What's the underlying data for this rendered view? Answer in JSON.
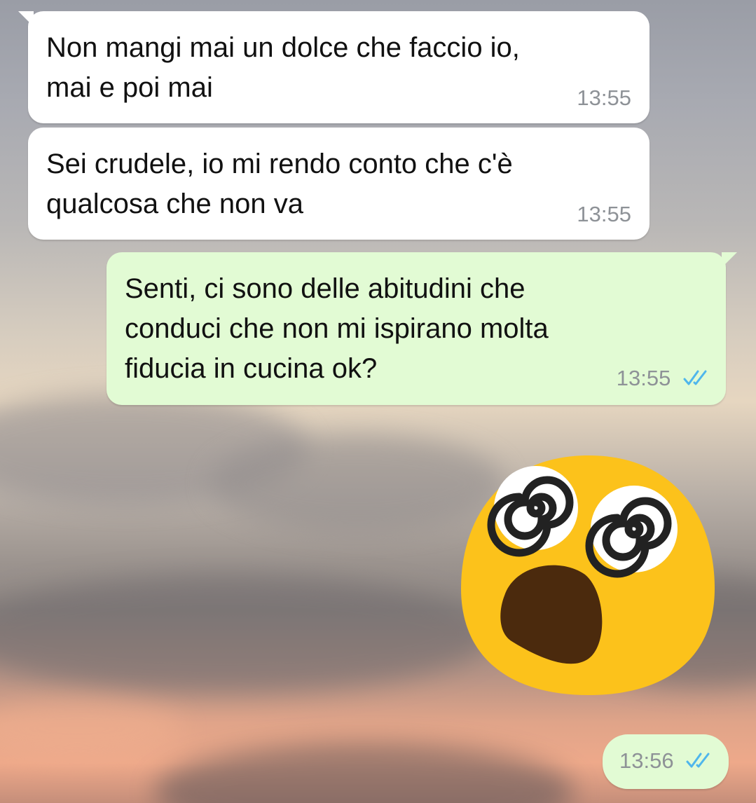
{
  "messages": [
    {
      "direction": "incoming",
      "text": "Non mangi mai un dolce che faccio io,\nmai e poi mai",
      "time": "13:55"
    },
    {
      "direction": "incoming",
      "text": "Sei crudele, io mi rendo conto che c'è\nqualcosa che non va",
      "time": "13:55"
    },
    {
      "direction": "outgoing",
      "text": "Senti, ci sono delle abitudini che\nconduci che non mi ispirano molta\nfiducia in cucina ok?",
      "time": "13:55",
      "status_icon": "double-check-icon"
    },
    {
      "direction": "outgoing",
      "type": "sticker",
      "icon": "dizzy-shocked-face-emoji",
      "time": "13:56",
      "status_icon": "double-check-icon"
    }
  ],
  "colors": {
    "incoming_bubble": "#ffffff",
    "outgoing_bubble": "#e2fbd4",
    "timestamp": "#8e9297",
    "read_ticks": "#4fb6ec",
    "emoji_yellow": "#fcc21b",
    "emoji_mouth": "#4b2a0d"
  }
}
